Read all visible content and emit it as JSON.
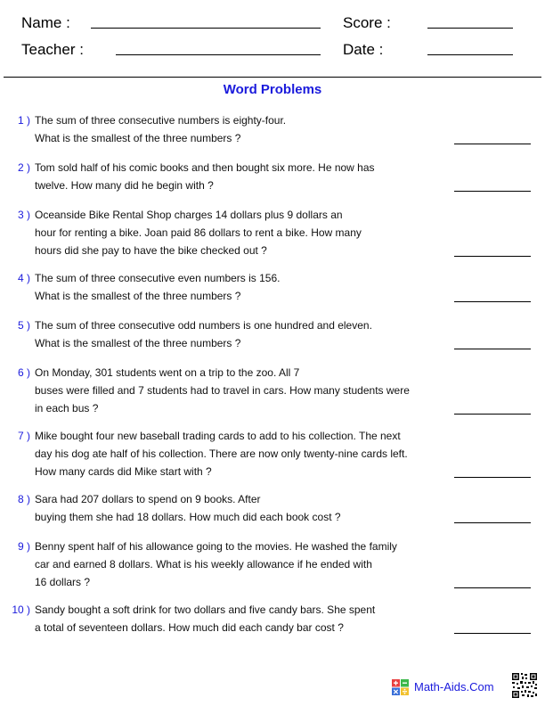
{
  "header": {
    "name_label": "Name :",
    "teacher_label": "Teacher :",
    "score_label": "Score :",
    "date_label": "Date :"
  },
  "title": "Word Problems",
  "problems": [
    {
      "number": "1 )",
      "lines": [
        "The sum of three consecutive numbers is eighty-four.",
        "What is the smallest of the three numbers ?"
      ]
    },
    {
      "number": "2 )",
      "lines": [
        "Tom sold half of his comic books and then bought six more. He now has",
        "twelve. How many did he begin with ?"
      ]
    },
    {
      "number": "3 )",
      "lines": [
        "Oceanside Bike Rental Shop charges 14 dollars plus 9 dollars an",
        "hour for renting a bike. Joan paid 86 dollars to rent a bike. How many",
        "hours did she pay to have the bike checked out ?"
      ]
    },
    {
      "number": "4 )",
      "lines": [
        "The sum of three consecutive even numbers is 156.",
        "What is the smallest of the three numbers ?"
      ]
    },
    {
      "number": "5 )",
      "lines": [
        "The sum of three consecutive odd numbers is one hundred and eleven.",
        "What is the smallest of the three numbers ?"
      ]
    },
    {
      "number": "6 )",
      "lines": [
        "On Monday, 301 students went on a trip to the zoo. All 7",
        "buses were filled and 7 students had to travel in cars. How many students were",
        "in each bus ?"
      ]
    },
    {
      "number": "7 )",
      "lines": [
        "Mike bought four new baseball trading cards to add to his collection. The next",
        "day his dog ate half of his collection. There are now only twenty-nine cards left.",
        "How many cards did Mike start with ?"
      ]
    },
    {
      "number": "8 )",
      "lines": [
        "Sara had 207 dollars to spend on 9 books. After",
        "buying them she had 18 dollars. How much did each book cost ?"
      ]
    },
    {
      "number": "9 )",
      "lines": [
        "Benny spent half of his allowance going to the movies. He washed the family",
        "car and earned 8 dollars. What is his weekly allowance if he ended with",
        "16 dollars ?"
      ]
    },
    {
      "number": "10 )",
      "lines": [
        "Sandy bought a soft drink for two dollars and five candy bars. She spent",
        "a total of seventeen dollars. How much did each candy bar cost ?"
      ]
    }
  ],
  "footer": {
    "logo_icon": "math-operations-icon",
    "site": "Math-Aids.Com",
    "qr_icon": "qr-code-icon"
  },
  "colors": {
    "accent": "#1a1adc"
  }
}
